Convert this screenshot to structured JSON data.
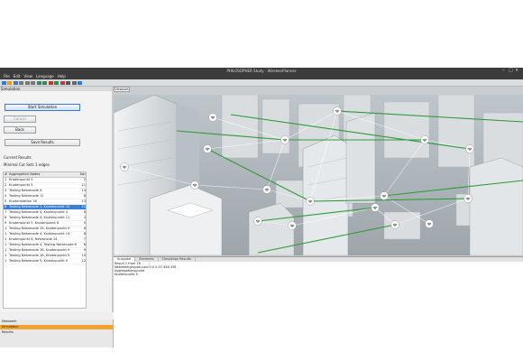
{
  "window": {
    "title": "PHILOSOPHER Study - WirelessPlanner",
    "controls": [
      "–",
      "□",
      "×"
    ]
  },
  "menu": [
    "File",
    "Edit",
    "View",
    "Language",
    "Help"
  ],
  "toolbar": {
    "icons": [
      "new-icon",
      "open-icon",
      "save-icon",
      "cut-icon",
      "copy-icon",
      "paste-icon",
      "undo-icon",
      "redo-icon",
      "zoom-icon",
      "play-icon",
      "stop-icon",
      "settings-icon",
      "grid-icon",
      "help-icon"
    ],
    "colors": [
      "#3b78c2",
      "#e0a020",
      "#3b78c2",
      "#777777",
      "#777777",
      "#777777",
      "#2e8b57",
      "#2e8b57",
      "#c0392b",
      "#2e8b57",
      "#c0392b",
      "#555555",
      "#666666",
      "#3b78c2"
    ]
  },
  "left_panel": {
    "header": "Simulation",
    "buttons": {
      "start": "Start Simulation",
      "cancel": "Cancel",
      "back": "Back",
      "save": "Save Results"
    },
    "results_label": "Current Results",
    "summary": "Minimal Cut Sets 1 edges",
    "table": {
      "headers": [
        "#",
        "Aggregation Nodes",
        "Kar"
      ],
      "rows": [
        {
          "n": "1",
          "name": "Knotenpunkt 5",
          "c": "2"
        },
        {
          "n": "2",
          "name": "Knotenpunkt 5",
          "c": "11"
        },
        {
          "n": "3",
          "name": "Testing Netzecode 4",
          "c": "13"
        },
        {
          "n": "4",
          "name": "Testing Netzecode 11",
          "c": "8"
        },
        {
          "n": "5",
          "name": "Knotenstation 16",
          "c": "13"
        },
        {
          "n": "6",
          "name": "Testing Netzecode 1, Knotenpunkt 14",
          "c": "11"
        },
        {
          "n": "7",
          "name": "Testing Netzecode 4, Knotenpunkt 4",
          "c": "6"
        },
        {
          "n": "8",
          "name": "Testing Netzecode 4, Knotenpunkt 11",
          "c": "4"
        },
        {
          "n": "9",
          "name": "Knotenpunkt 5, Knotenpunkt 6",
          "c": "5"
        },
        {
          "n": "1",
          "name": "Testing Netzecode 16, Knotenpunkt 9",
          "c": "6"
        },
        {
          "n": "1",
          "name": "Testing Netzecode 4, Knotenpunkt 14",
          "c": "8"
        },
        {
          "n": "1",
          "name": "Knotenpunkt 6, Netzecode 14",
          "c": "7"
        },
        {
          "n": "1",
          "name": "Testing Netzecode 4, Testing Netzecode 6",
          "c": "8"
        },
        {
          "n": "1",
          "name": "Testing Netzecode 16, Knotenpunkt 9",
          "c": "9"
        },
        {
          "n": "1",
          "name": "Testing Netzecode 16, Knotenpunkt 9",
          "c": "10"
        },
        {
          "n": "1",
          "name": "Testing Netzecode 5, Knotenpunkt 9",
          "c": "12"
        }
      ],
      "selected_index": 5
    }
  },
  "viewport": {
    "tab": "Viewport"
  },
  "bottom_tabs": [
    "Ausgabe",
    "Elements",
    "Simulation Results"
  ],
  "log_lines": [
    "Result 1 from 16",
    "Netzwerkgruppe.Lauf.0.0 0.07.456.336",
    "Aggregationspunkt",
    "Knotenpunkt 5"
  ],
  "bottom_left": {
    "items": [
      "Netzwerk",
      "Simulation",
      "Results"
    ],
    "active_index": 1,
    "accent": "#f0a330"
  }
}
